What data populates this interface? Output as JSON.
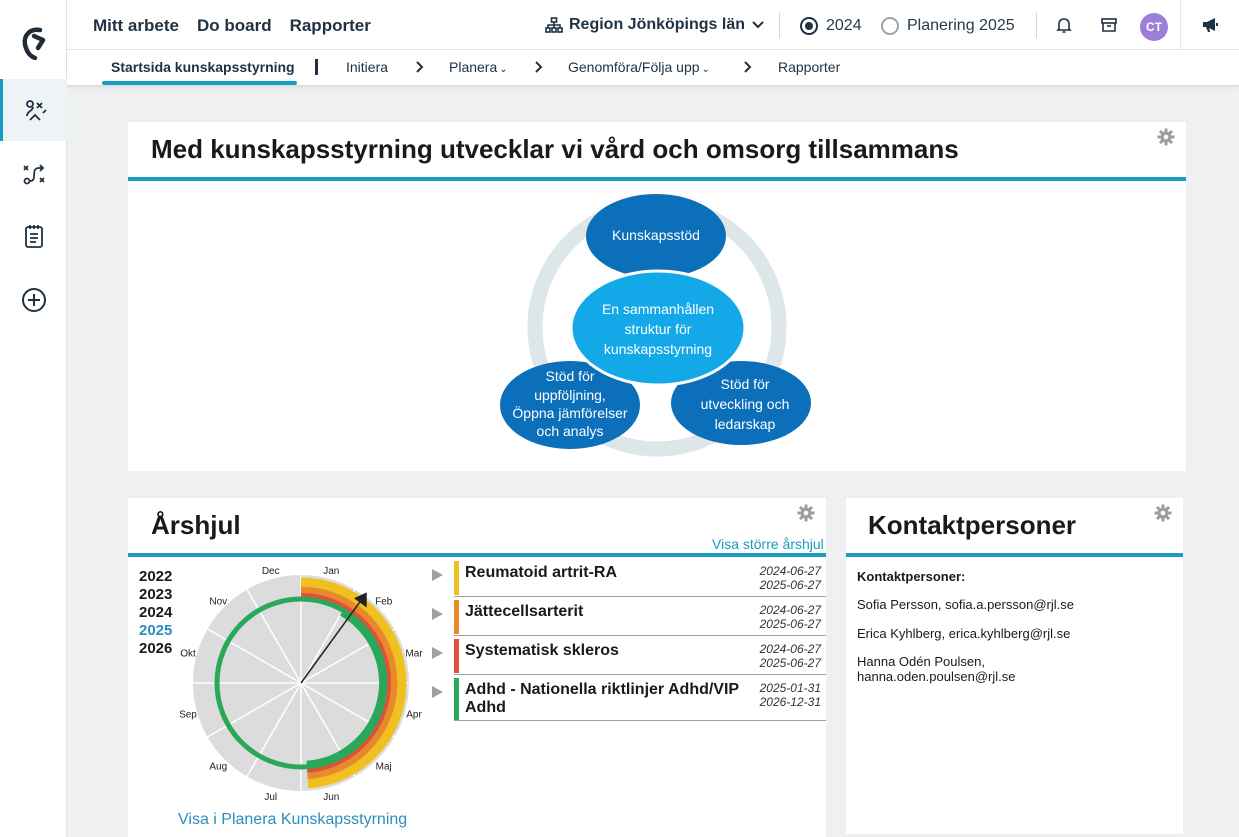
{
  "topnav": {
    "items": [
      "Mitt arbete",
      "Do board",
      "Rapporter"
    ]
  },
  "region": {
    "label": "Region Jönköpings län"
  },
  "years_toggle": {
    "option1": "2024",
    "option2": "Planering 2025"
  },
  "user": {
    "initials": "CT"
  },
  "subnav": {
    "home": "Startsida kunskapsstyrning",
    "initiera": "Initiera",
    "planera": "Planera",
    "genomfora": "Genomföra/Följa upp",
    "rapporter": "Rapporter"
  },
  "hero": {
    "title": "Med kunskapsstyrning utvecklar vi vård och omsorg tillsammans",
    "diagram": {
      "top": "Kunskapsstöd",
      "center": [
        "En sammanhållen",
        "struktur för",
        "kunskapsstyrning"
      ],
      "left": [
        "Stöd för",
        "uppföljning,",
        "Öppna jämförelser",
        "och analys"
      ],
      "right": [
        "Stöd för",
        "utveckling och",
        "ledarskap"
      ]
    }
  },
  "arshjul": {
    "title": "Årshjul",
    "link_larger": "Visa större årshjul",
    "years": [
      "2022",
      "2023",
      "2024",
      "2025",
      "2026"
    ],
    "current_year": "2025",
    "months": [
      "Jan",
      "Feb",
      "Mar",
      "Apr",
      "Maj",
      "Jun",
      "Jul",
      "Aug",
      "Sep",
      "Okt",
      "Nov",
      "Dec"
    ],
    "events": [
      {
        "name": "Reumatoid artrit-RA",
        "start": "2024-06-27",
        "end": "2025-06-27",
        "color": "#f0c020"
      },
      {
        "name": "Jättecellsarterit",
        "start": "2024-06-27",
        "end": "2025-06-27",
        "color": "#e88a2a"
      },
      {
        "name": "Systematisk skleros",
        "start": "2024-06-27",
        "end": "2025-06-27",
        "color": "#e0503a"
      },
      {
        "name": "Adhd - Nationella riktlinjer Adhd/VIP Adhd",
        "start": "2025-01-31",
        "end": "2026-12-31",
        "color": "#2aa85a"
      }
    ],
    "footer_link": "Visa i Planera Kunskapsstyrning"
  },
  "contacts": {
    "title": "Kontaktpersoner",
    "heading": "Kontaktpersoner:",
    "people": [
      "Sofia Persson, sofia.a.persson@rjl.se",
      "Erica Kyhlberg, erica.kyhlberg@rjl.se",
      "Hanna Odén Poulsen,",
      "hanna.oden.poulsen@rjl.se"
    ]
  },
  "colors": {
    "accent": "#1a9bc2",
    "diagram_dark": "#0b6fba",
    "diagram_light": "#13a9e8"
  }
}
